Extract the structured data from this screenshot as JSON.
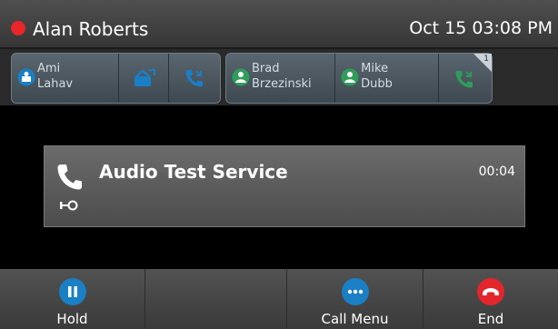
{
  "status": {
    "user_name": "Alan Roberts",
    "datetime": "Oct 15 03:08 PM",
    "presence_color": "#e8262a"
  },
  "lines": {
    "contact_1_first": "Ami",
    "contact_1_last": "Lahav",
    "contact_2_first": "Brad",
    "contact_2_last": "Brzezinski",
    "contact_3_first": "Mike",
    "contact_3_last": "Dubb",
    "badge_count": "1"
  },
  "call": {
    "name": "Audio Test Service",
    "timer": "00:04"
  },
  "softkeys": {
    "hold": "Hold",
    "call_menu": "Call Menu",
    "end": "End"
  },
  "colors": {
    "accent_blue": "#1a7fc4",
    "end_red": "#e3262b",
    "presence_green": "#2e9d5a"
  }
}
